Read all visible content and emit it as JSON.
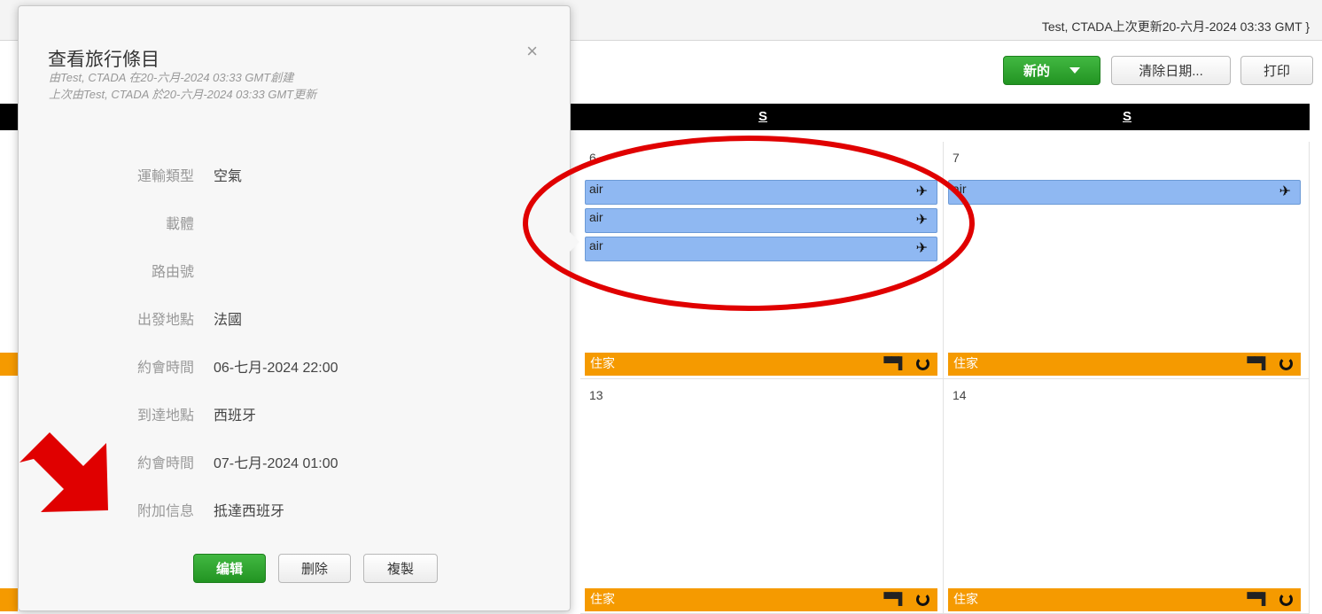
{
  "topbar": {
    "status": "Test, CTADA上次更新20-六月-2024 03:33 GMT }"
  },
  "toolbar": {
    "new_label": "新的",
    "clear_label": "清除日期...",
    "print_label": "打印"
  },
  "day_header": [
    "S",
    "S"
  ],
  "calendar": {
    "cells": [
      {
        "num": "6",
        "events": [
          "air",
          "air",
          "air"
        ],
        "home": "住家"
      },
      {
        "num": "7",
        "events": [
          "air"
        ],
        "home": "住家"
      },
      {
        "num": "13",
        "events": [],
        "home": "住家"
      },
      {
        "num": "14",
        "events": [],
        "home": "住家"
      }
    ]
  },
  "popover": {
    "title": "查看旅行條目",
    "created": "由Test, CTADA 在20-六月-2024 03:33 GMT創建",
    "updated": "上次由Test, CTADA 於20-六月-2024 03:33 GMT更新",
    "close": "×",
    "fields": [
      {
        "label": "運輸類型",
        "value": "空氣"
      },
      {
        "label": "載體",
        "value": ""
      },
      {
        "label": "路由號",
        "value": ""
      },
      {
        "label": "出發地點",
        "value": "法國"
      },
      {
        "label": "約會時間",
        "value": "06-七月-2024 22:00"
      },
      {
        "label": "到達地點",
        "value": "西班牙"
      },
      {
        "label": "約會時間",
        "value": "07-七月-2024 01:00"
      },
      {
        "label": "附加信息",
        "value": "抵達西班牙"
      }
    ],
    "buttons": {
      "edit": "编辑",
      "delete": "删除",
      "copy": "複製"
    }
  },
  "icons": {
    "plane": "plane-icon",
    "bed": "bed-icon",
    "recurring": "recurring-icon",
    "close": "close-icon",
    "caret": "caret-down-icon"
  },
  "colors": {
    "air_event": "#8fb8f2",
    "home_event": "#f59a00",
    "primary_button": "#2aa22a",
    "annotation_red": "#e00000",
    "header_bar": "#000000"
  }
}
